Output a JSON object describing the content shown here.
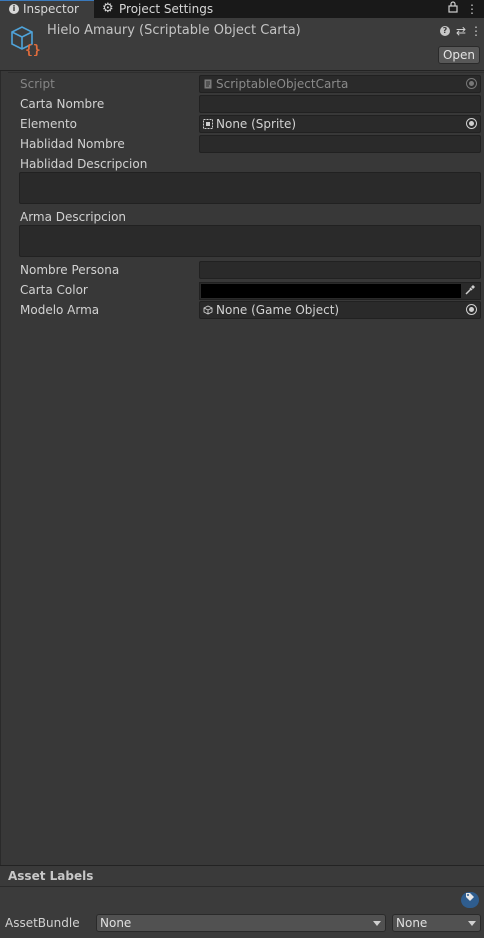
{
  "tabs": [
    {
      "label": "Inspector",
      "icon": "info-icon"
    },
    {
      "label": "Project Settings",
      "icon": "gear-icon"
    }
  ],
  "header": {
    "title": "Hielo Amaury (Scriptable Object Carta)",
    "open_button": "Open"
  },
  "fields": {
    "script": {
      "label": "Script",
      "value": "ScriptableObjectCarta"
    },
    "carta_nombre": {
      "label": "Carta Nombre",
      "value": ""
    },
    "elemento": {
      "label": "Elemento",
      "value": "None (Sprite)"
    },
    "habilidad_nombre": {
      "label": "Hablidad Nombre",
      "value": ""
    },
    "habilidad_descripcion": {
      "label": "Hablidad Descripcion",
      "value": ""
    },
    "arma_descripcion": {
      "label": "Arma Descripcion",
      "value": ""
    },
    "nombre_persona": {
      "label": "Nombre Persona",
      "value": ""
    },
    "carta_color": {
      "label": "Carta Color",
      "value": "#000000"
    },
    "modelo_arma": {
      "label": "Modelo Arma",
      "value": "None (Game Object)"
    }
  },
  "asset_labels": {
    "title": "Asset Labels",
    "bundle_label": "AssetBundle",
    "bundle_value": "None",
    "variant_value": "None"
  },
  "colors": {
    "background": "#383838",
    "accent": "#3a79bb",
    "script_brace": "#e06c3c",
    "cube": "#4fa3d9"
  }
}
